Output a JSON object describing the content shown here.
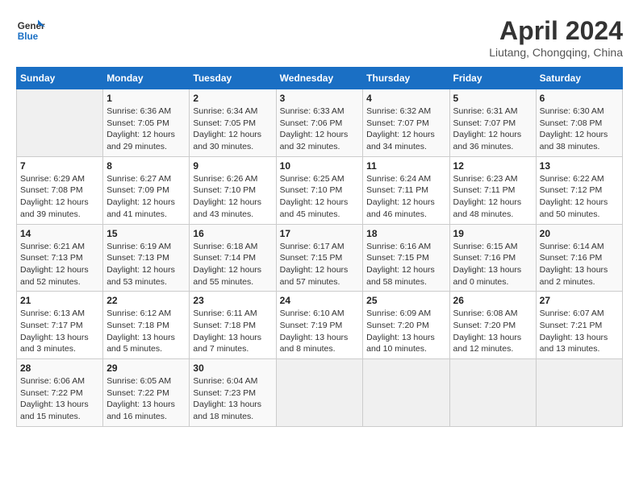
{
  "logo": {
    "line1": "General",
    "line2": "Blue"
  },
  "title": "April 2024",
  "location": "Liutang, Chongqing, China",
  "weekdays": [
    "Sunday",
    "Monday",
    "Tuesday",
    "Wednesday",
    "Thursday",
    "Friday",
    "Saturday"
  ],
  "weeks": [
    [
      {
        "day": "",
        "info": ""
      },
      {
        "day": "1",
        "info": "Sunrise: 6:36 AM\nSunset: 7:05 PM\nDaylight: 12 hours\nand 29 minutes."
      },
      {
        "day": "2",
        "info": "Sunrise: 6:34 AM\nSunset: 7:05 PM\nDaylight: 12 hours\nand 30 minutes."
      },
      {
        "day": "3",
        "info": "Sunrise: 6:33 AM\nSunset: 7:06 PM\nDaylight: 12 hours\nand 32 minutes."
      },
      {
        "day": "4",
        "info": "Sunrise: 6:32 AM\nSunset: 7:07 PM\nDaylight: 12 hours\nand 34 minutes."
      },
      {
        "day": "5",
        "info": "Sunrise: 6:31 AM\nSunset: 7:07 PM\nDaylight: 12 hours\nand 36 minutes."
      },
      {
        "day": "6",
        "info": "Sunrise: 6:30 AM\nSunset: 7:08 PM\nDaylight: 12 hours\nand 38 minutes."
      }
    ],
    [
      {
        "day": "7",
        "info": "Sunrise: 6:29 AM\nSunset: 7:08 PM\nDaylight: 12 hours\nand 39 minutes."
      },
      {
        "day": "8",
        "info": "Sunrise: 6:27 AM\nSunset: 7:09 PM\nDaylight: 12 hours\nand 41 minutes."
      },
      {
        "day": "9",
        "info": "Sunrise: 6:26 AM\nSunset: 7:10 PM\nDaylight: 12 hours\nand 43 minutes."
      },
      {
        "day": "10",
        "info": "Sunrise: 6:25 AM\nSunset: 7:10 PM\nDaylight: 12 hours\nand 45 minutes."
      },
      {
        "day": "11",
        "info": "Sunrise: 6:24 AM\nSunset: 7:11 PM\nDaylight: 12 hours\nand 46 minutes."
      },
      {
        "day": "12",
        "info": "Sunrise: 6:23 AM\nSunset: 7:11 PM\nDaylight: 12 hours\nand 48 minutes."
      },
      {
        "day": "13",
        "info": "Sunrise: 6:22 AM\nSunset: 7:12 PM\nDaylight: 12 hours\nand 50 minutes."
      }
    ],
    [
      {
        "day": "14",
        "info": "Sunrise: 6:21 AM\nSunset: 7:13 PM\nDaylight: 12 hours\nand 52 minutes."
      },
      {
        "day": "15",
        "info": "Sunrise: 6:19 AM\nSunset: 7:13 PM\nDaylight: 12 hours\nand 53 minutes."
      },
      {
        "day": "16",
        "info": "Sunrise: 6:18 AM\nSunset: 7:14 PM\nDaylight: 12 hours\nand 55 minutes."
      },
      {
        "day": "17",
        "info": "Sunrise: 6:17 AM\nSunset: 7:15 PM\nDaylight: 12 hours\nand 57 minutes."
      },
      {
        "day": "18",
        "info": "Sunrise: 6:16 AM\nSunset: 7:15 PM\nDaylight: 12 hours\nand 58 minutes."
      },
      {
        "day": "19",
        "info": "Sunrise: 6:15 AM\nSunset: 7:16 PM\nDaylight: 13 hours\nand 0 minutes."
      },
      {
        "day": "20",
        "info": "Sunrise: 6:14 AM\nSunset: 7:16 PM\nDaylight: 13 hours\nand 2 minutes."
      }
    ],
    [
      {
        "day": "21",
        "info": "Sunrise: 6:13 AM\nSunset: 7:17 PM\nDaylight: 13 hours\nand 3 minutes."
      },
      {
        "day": "22",
        "info": "Sunrise: 6:12 AM\nSunset: 7:18 PM\nDaylight: 13 hours\nand 5 minutes."
      },
      {
        "day": "23",
        "info": "Sunrise: 6:11 AM\nSunset: 7:18 PM\nDaylight: 13 hours\nand 7 minutes."
      },
      {
        "day": "24",
        "info": "Sunrise: 6:10 AM\nSunset: 7:19 PM\nDaylight: 13 hours\nand 8 minutes."
      },
      {
        "day": "25",
        "info": "Sunrise: 6:09 AM\nSunset: 7:20 PM\nDaylight: 13 hours\nand 10 minutes."
      },
      {
        "day": "26",
        "info": "Sunrise: 6:08 AM\nSunset: 7:20 PM\nDaylight: 13 hours\nand 12 minutes."
      },
      {
        "day": "27",
        "info": "Sunrise: 6:07 AM\nSunset: 7:21 PM\nDaylight: 13 hours\nand 13 minutes."
      }
    ],
    [
      {
        "day": "28",
        "info": "Sunrise: 6:06 AM\nSunset: 7:22 PM\nDaylight: 13 hours\nand 15 minutes."
      },
      {
        "day": "29",
        "info": "Sunrise: 6:05 AM\nSunset: 7:22 PM\nDaylight: 13 hours\nand 16 minutes."
      },
      {
        "day": "30",
        "info": "Sunrise: 6:04 AM\nSunset: 7:23 PM\nDaylight: 13 hours\nand 18 minutes."
      },
      {
        "day": "",
        "info": ""
      },
      {
        "day": "",
        "info": ""
      },
      {
        "day": "",
        "info": ""
      },
      {
        "day": "",
        "info": ""
      }
    ]
  ]
}
